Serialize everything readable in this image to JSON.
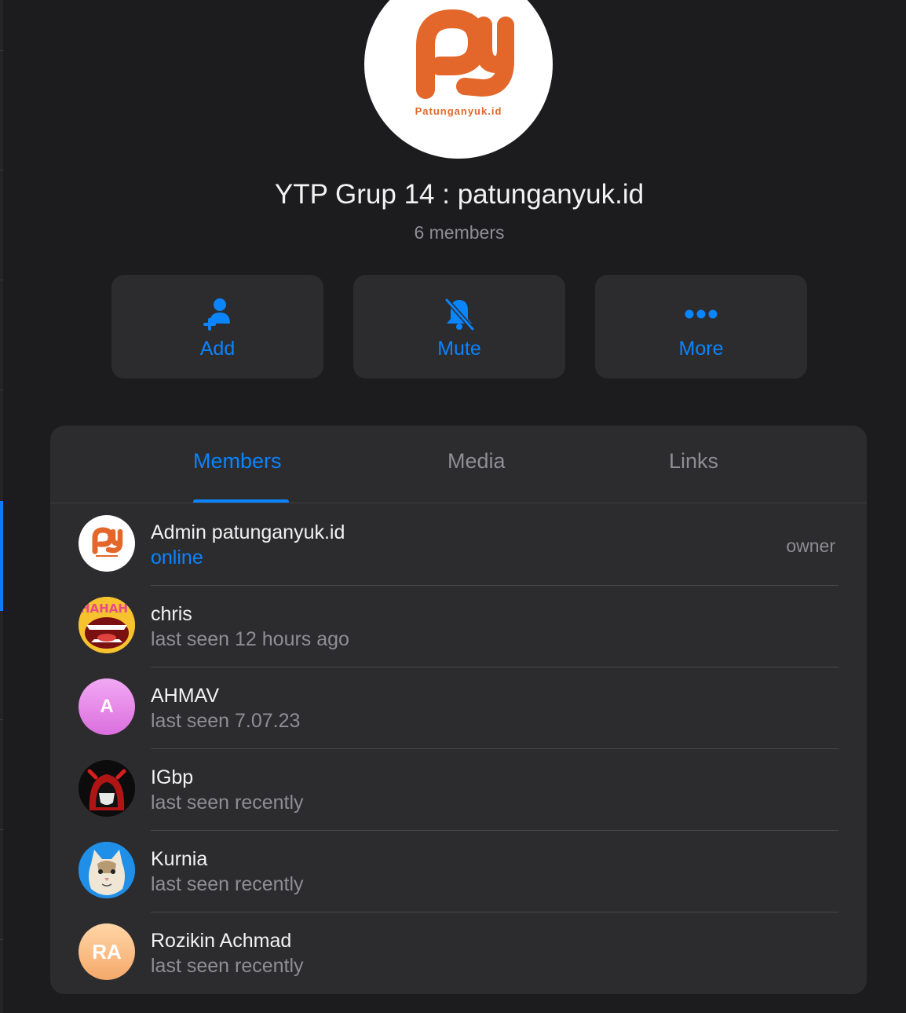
{
  "group": {
    "title": "YTP Grup 14 : patunganyuk.id",
    "subtitle": "6 members",
    "avatar_brand_text": "Patunganyuk.id",
    "brand_color": "#e3672a"
  },
  "actions": [
    {
      "label": "Add",
      "icon": "add-member-icon"
    },
    {
      "label": "Mute",
      "icon": "bell-slash-icon"
    },
    {
      "label": "More",
      "icon": "ellipsis-icon"
    }
  ],
  "tabs": [
    {
      "label": "Members",
      "active": true
    },
    {
      "label": "Media",
      "active": false
    },
    {
      "label": "Links",
      "active": false
    }
  ],
  "members": [
    {
      "name": "Admin patunganyuk.id",
      "status": "online",
      "role": "owner",
      "avatar": "patunganyuk-logo"
    },
    {
      "name": "chris",
      "status": "last seen 12 hours ago",
      "role": "",
      "avatar": "laughing-mouth-image"
    },
    {
      "name": "AHMAV",
      "status": "last seen 7.07.23",
      "role": "",
      "avatar_initials": "A"
    },
    {
      "name": "IGbp",
      "status": "last seen recently",
      "role": "",
      "avatar": "hooded-devil-image"
    },
    {
      "name": "Kurnia",
      "status": "last seen recently",
      "role": "",
      "avatar": "cat-image"
    },
    {
      "name": "Rozikin Achmad",
      "status": "last seen recently",
      "role": "",
      "avatar_initials": "RA"
    }
  ],
  "colors": {
    "accent": "#0a84ff",
    "background": "#1c1c1e",
    "panel": "#2c2c2e",
    "secondary_text": "#8e8e93"
  }
}
